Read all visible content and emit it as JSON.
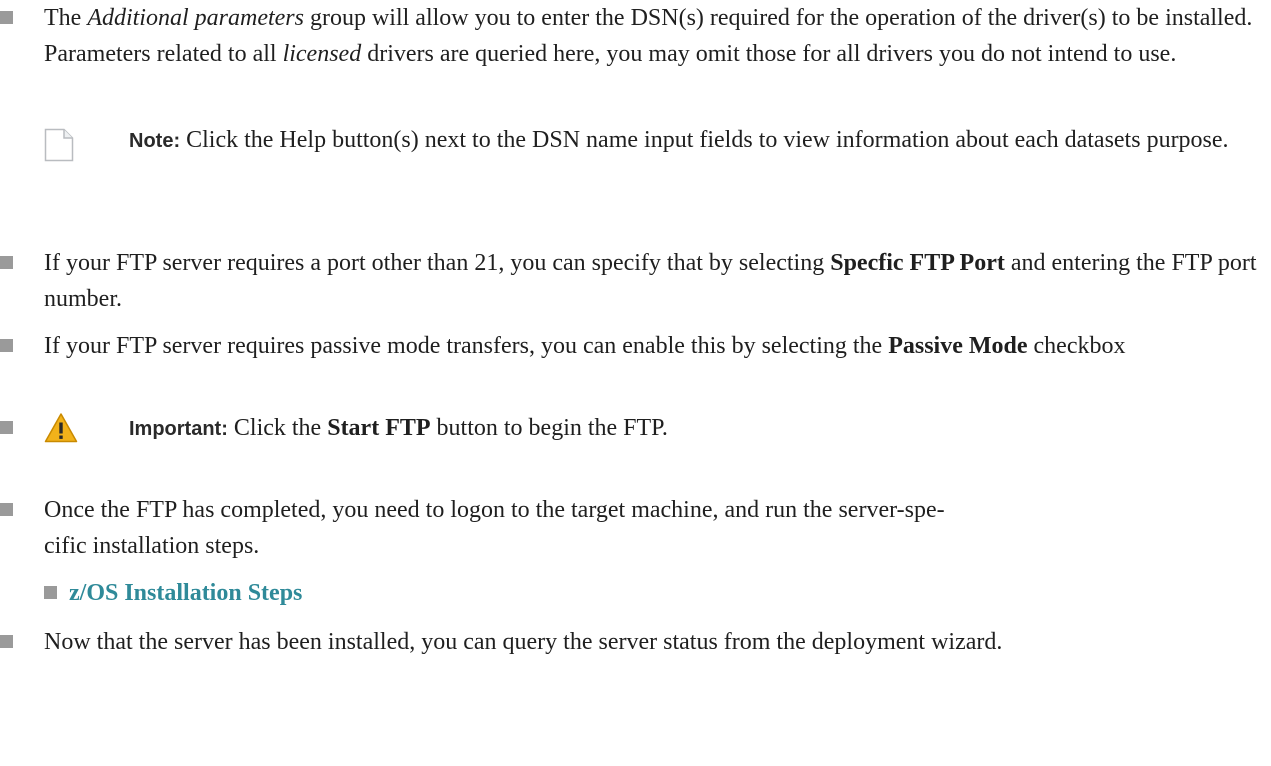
{
  "bullet1": {
    "t1": "The ",
    "t2": "Additional parameters",
    "t3": " group will allow you to enter the DSN(s) required for the operation of the driver(s) to be installed. Parameters related to all ",
    "t4": "licensed",
    "t5": " drivers are queried here, you may omit those for all drivers you do not intend to use."
  },
  "note": {
    "icon": "document-icon",
    "label": "Note:",
    "text": "Click the Help button(s) next to the DSN name input fields to view information about each datasets purpose."
  },
  "bullet2": {
    "t1": "If your FTP server requires a port other than 21, you can specify that by selecting ",
    "b1": "Specfic FTP Port",
    "t2": " and entering the FTP port number."
  },
  "bullet3": {
    "t1": "If your FTP server requires passive mode transfers, you can enable this by selecting the ",
    "b1": "Passive Mode",
    "t2": " checkbox"
  },
  "important": {
    "icon": "warning-icon",
    "label": "Important:",
    "t1": "Click the ",
    "b1": "Start FTP",
    "t2": " button to begin the FTP.",
    "icon_color": "#f2b21a"
  },
  "bullet4": {
    "t1": "Once the FTP has completed, you need to logon to the target machine, and run the server-spe-",
    "t2": "cific installation steps."
  },
  "sublink": {
    "label": "z/OS Installation Steps",
    "color": "#2f8a99"
  },
  "bullet5": {
    "t1": "Now that the server has been installed, you can query the server status from the deployment wizard."
  }
}
